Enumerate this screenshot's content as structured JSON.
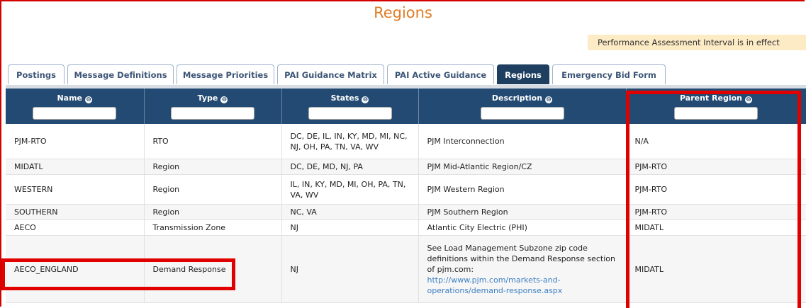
{
  "page": {
    "title": "Regions"
  },
  "banner": {
    "text": "Performance Assessment Interval is in effect"
  },
  "tabs": [
    {
      "label": "Postings"
    },
    {
      "label": "Message Definitions"
    },
    {
      "label": "Message Priorities"
    },
    {
      "label": "PAI Guidance Matrix"
    },
    {
      "label": "PAI Active Guidance"
    },
    {
      "label": "Regions"
    },
    {
      "label": "Emergency Bid Form"
    }
  ],
  "active_tab": "Regions",
  "table": {
    "columns": [
      {
        "label": "Name",
        "filter_icon": "⊖"
      },
      {
        "label": "Type",
        "filter_icon": "⊖"
      },
      {
        "label": "States",
        "filter_icon": "⊖"
      },
      {
        "label": "Description",
        "filter_icon": "⊖"
      },
      {
        "label": "Parent Region",
        "filter_icon": "⊖"
      }
    ],
    "rows": [
      {
        "name": "PJM-RTO",
        "type": "RTO",
        "states": "DC, DE, IL, IN, KY, MD, MI, NC, NJ, OH, PA, TN, VA, WV",
        "description": "PJM Interconnection",
        "parent": "N/A"
      },
      {
        "name": "MIDATL",
        "type": "Region",
        "states": "DC, DE, MD, NJ, PA",
        "description": "PJM Mid-Atlantic Region/CZ",
        "parent": "PJM-RTO"
      },
      {
        "name": "WESTERN",
        "type": "Region",
        "states": "IL, IN, KY, MD, MI, OH, PA, TN, VA, WV",
        "description": "PJM Western Region",
        "parent": "PJM-RTO"
      },
      {
        "name": "SOUTHERN",
        "type": "Region",
        "states": "NC, VA",
        "description": "PJM Southern Region",
        "parent": "PJM-RTO"
      },
      {
        "name": "AECO",
        "type": "Transmission Zone",
        "states": "NJ",
        "description": "Atlantic City Electric (PHI)",
        "parent": "MIDATL"
      },
      {
        "name": "AECO_ENGLAND",
        "type": "Demand Response",
        "states": "NJ",
        "description": "See Load Management Subzone zip code definitions within the Demand Response section of pjm.com:",
        "description_link": "http://www.pjm.com/markets-and-operations/demand-response.aspx",
        "parent": "MIDATL"
      }
    ]
  },
  "colors": {
    "title": "#e07b21",
    "header_bg": "#234a72",
    "active_tab_bg": "#1f3f60",
    "banner_bg": "#fdebc5",
    "highlight": "#e00000",
    "link": "#3d7fc4"
  }
}
